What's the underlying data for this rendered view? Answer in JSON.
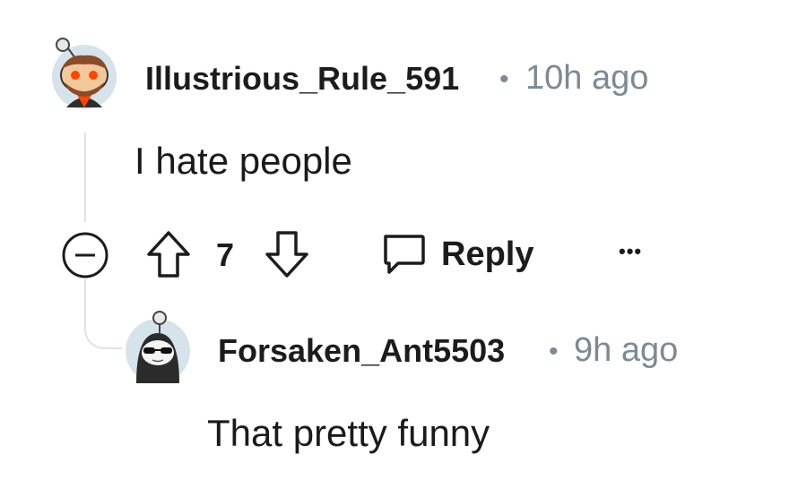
{
  "comment": {
    "username": "Illustrious_Rule_591",
    "separator": "•",
    "time": "10h ago",
    "body": "I hate people",
    "score": "7",
    "reply_label": "Reply",
    "more_label": "•••"
  },
  "reply": {
    "username": "Forsaken_Ant5503",
    "separator": "•",
    "time": "9h ago",
    "body": "That pretty funny"
  },
  "colors": {
    "meta": "#7c8a93",
    "thread_line": "#e0e3e5",
    "avatar_bg": "#d7e3ea",
    "snoo_eyes": "#ff4500"
  }
}
